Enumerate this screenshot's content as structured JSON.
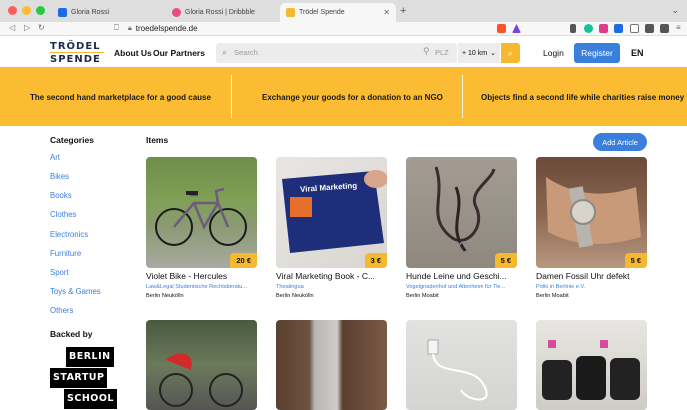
{
  "browser": {
    "tabs": [
      {
        "label": "Gloria Rossi",
        "fav_color": "#1d6ae5"
      },
      {
        "label": "Gloria Rossi | Dribbble",
        "fav_color": "#ea4c89"
      },
      {
        "label": "Trödel Spende",
        "fav_color": "#f5b82e"
      }
    ],
    "new_tab": "+",
    "url": "troedelspende.de",
    "traffic_colors": [
      "#fe5f57",
      "#febc2e",
      "#28c840"
    ]
  },
  "header": {
    "logo_line1": "TRÖDEL",
    "logo_line2": "SPENDE",
    "about": "About Us",
    "partners": "Our Partners",
    "search_placeholder": "Search",
    "plz_placeholder": "PLZ",
    "distance": "+ 10 km",
    "login": "Login",
    "register": "Register",
    "lang": "EN"
  },
  "banner": {
    "messages": [
      "The second hand marketplace for a good cause",
      "Exchange your goods for a donation to an NGO",
      "Objects find a second life while charities raise money"
    ]
  },
  "sidebar": {
    "title": "Categories",
    "items": [
      "Art",
      "Bikes",
      "Books",
      "Clothes",
      "Electronics",
      "Furniture",
      "Sport",
      "Toys & Games",
      "Others"
    ],
    "backed_by": "Backed by",
    "bss": [
      "BERLIN",
      "STARTUP",
      "SCHOOL"
    ]
  },
  "main": {
    "title": "Items",
    "add_button": "Add Article",
    "items": [
      {
        "title": "Violet Bike - Hercules",
        "org": "Law&Legal Studentische Rechtsberatu...",
        "location": "Berlin Neukölln",
        "price": "20 €"
      },
      {
        "title": "Viral Marketing Book - C...",
        "org": "Thealingua",
        "location": "Berlin Neukölln",
        "price": "3 €"
      },
      {
        "title": "Hunde Leine und Geschi...",
        "org": "Vogelgnadenhof und Altenheim für Tie...",
        "location": "Berlin Moabit",
        "price": "5 €"
      },
      {
        "title": "Damen Fossil Uhr defekt",
        "org": "Polki in Berlinie e.V.",
        "location": "Berlin Moabit",
        "price": "5 €"
      }
    ],
    "book_title": "Viral Marketing"
  },
  "colors": {
    "accent_yellow": "#fbbc33",
    "link_blue": "#3b7fdc"
  }
}
